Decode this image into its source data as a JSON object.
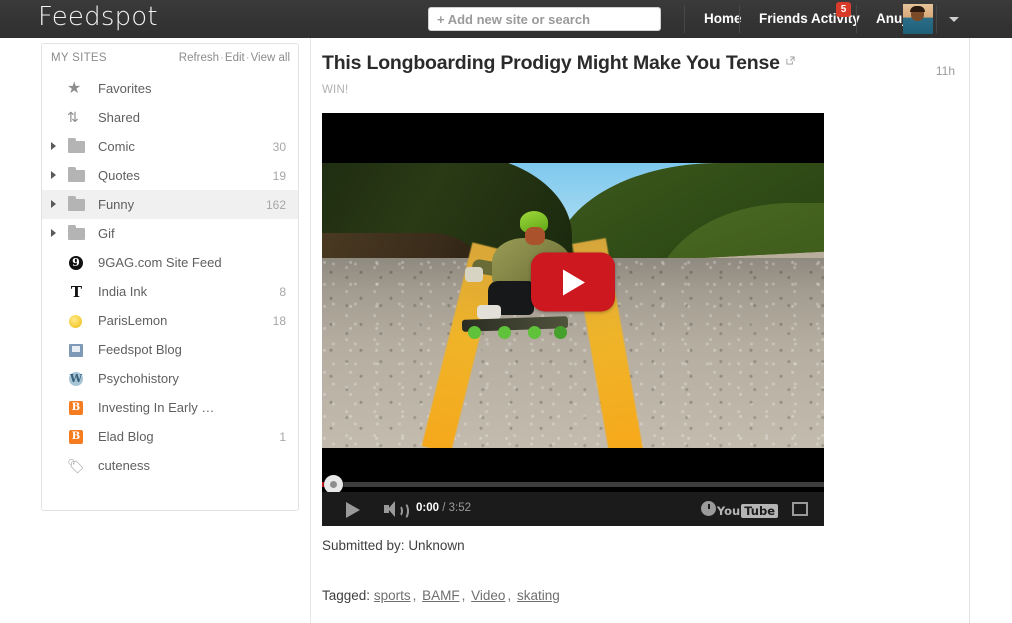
{
  "header": {
    "logo": "Feedspot",
    "search": {
      "value": "",
      "placeholder": "+ Add new site or search"
    },
    "nav": {
      "home": "Home",
      "friends_activity": "Friends Activity",
      "friends_badge": "5",
      "user": "Anuj"
    }
  },
  "sidebar": {
    "title": "MY SITES",
    "actions": {
      "refresh": "Refresh",
      "edit": "Edit",
      "view_all": "View all",
      "separator": "·"
    },
    "items": [
      {
        "label": "Favorites",
        "count": "",
        "icon": "star-icon",
        "arrow": false
      },
      {
        "label": "Shared",
        "count": "",
        "icon": "shared-icon",
        "arrow": false
      },
      {
        "label": "Comic",
        "count": "30",
        "icon": "folder-icon",
        "arrow": true
      },
      {
        "label": "Quotes",
        "count": "19",
        "icon": "folder-icon",
        "arrow": true
      },
      {
        "label": "Funny",
        "count": "162",
        "icon": "folder-icon",
        "arrow": true,
        "active": true
      },
      {
        "label": "Gif",
        "count": "",
        "icon": "folder-icon",
        "arrow": true
      },
      {
        "label": "9GAG.com Site Feed",
        "count": "",
        "icon": "ninegag-icon",
        "arrow": false
      },
      {
        "label": "India Ink",
        "count": "8",
        "icon": "nytimes-icon",
        "arrow": false
      },
      {
        "label": "ParisLemon",
        "count": "18",
        "icon": "lemon-icon",
        "arrow": false
      },
      {
        "label": "Feedspot Blog",
        "count": "",
        "icon": "feedspot-icon",
        "arrow": false
      },
      {
        "label": "Psychohistory",
        "count": "",
        "icon": "wordpress-icon",
        "arrow": false
      },
      {
        "label": "Investing In Early …",
        "count": "",
        "icon": "blogger-icon",
        "arrow": false
      },
      {
        "label": "Elad Blog",
        "count": "1",
        "icon": "blogger-icon",
        "arrow": false
      },
      {
        "label": "cuteness",
        "count": "",
        "icon": "tag-icon",
        "arrow": false
      }
    ]
  },
  "article": {
    "title": "This Longboarding Prodigy Might Make You Tense",
    "external_link_icon": "external-link-icon",
    "source": "WIN!",
    "time": "11h",
    "submitted_label": "Submitted by:",
    "submitted_by": "Unknown",
    "tagged_label": "Tagged:",
    "tags": [
      "sports",
      "BAMF",
      "Video",
      "skating"
    ],
    "tag_separator": ","
  },
  "video": {
    "play_button": "play-button",
    "current_time": "0:00",
    "duration": "3:52",
    "time_separator": " / ",
    "brand_you": "You",
    "brand_tube": "Tube"
  },
  "colors": {
    "navbar": "#333333",
    "badge_red": "#d93b2b",
    "youtube_red": "#cc181e",
    "active_row": "#f0f0f0",
    "blogger_orange": "#f57c20"
  }
}
